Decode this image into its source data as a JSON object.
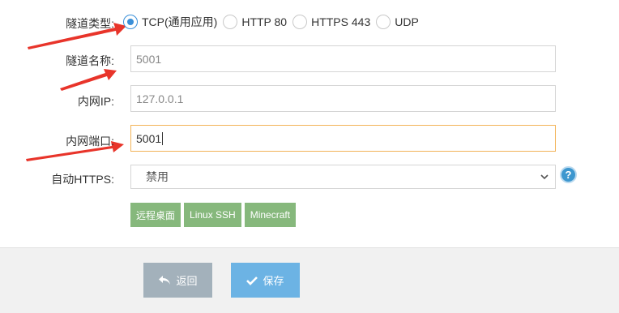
{
  "form": {
    "tunnel_type": {
      "label": "隧道类型:",
      "options": [
        {
          "label": "TCP(通用应用)",
          "checked": true
        },
        {
          "label": "HTTP 80",
          "checked": false
        },
        {
          "label": "HTTPS 443",
          "checked": false
        },
        {
          "label": "UDP",
          "checked": false
        }
      ]
    },
    "tunnel_name": {
      "label": "隧道名称:",
      "value": "5001"
    },
    "local_ip": {
      "label": "内网IP:",
      "value": "127.0.0.1"
    },
    "local_port": {
      "label": "内网端口:",
      "value": "5001"
    },
    "auto_https": {
      "label": "自动HTTPS:",
      "selected": "禁用"
    },
    "help_icon_glyph": "?",
    "presets": [
      "远程桌面",
      "Linux SSH",
      "Minecraft"
    ]
  },
  "footer": {
    "back_label": "返回",
    "save_label": "保存"
  },
  "colors": {
    "radio_accent": "#3a8fd8",
    "preset_green": "#86b87c",
    "back_gray": "#a3b1bb",
    "save_blue": "#6cb3e4",
    "focus_orange": "#f2b358",
    "arrow_red": "#e8342a"
  },
  "icons": {
    "back": "back-arrow-icon",
    "save": "checkmark-icon",
    "help": "question-icon",
    "select": "chevron-down-icon"
  }
}
